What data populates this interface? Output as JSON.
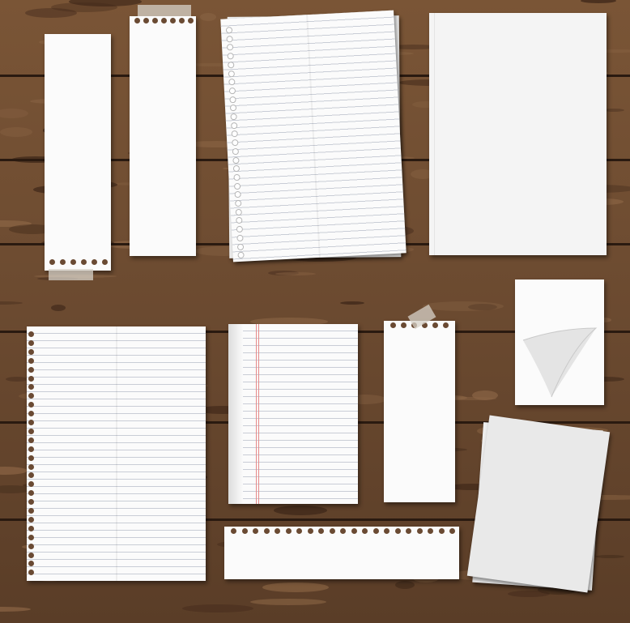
{
  "scene": {
    "background": "wood-planks",
    "wood_colors": {
      "base": "#6b4a30",
      "dark": "#3d2618",
      "light": "#8a6444",
      "seam": "#2a1a10"
    },
    "paper_color": "#fbfbfb",
    "line_color": "#c9cdd6",
    "margin_color": "#e58a8a"
  },
  "papers": [
    {
      "kind": "torn-strip-bottom-holes"
    },
    {
      "kind": "torn-strip-top-holes-taped"
    },
    {
      "kind": "ruled-spiral-sheet"
    },
    {
      "kind": "blank-sheet"
    },
    {
      "kind": "ruled-spiral-notebook-page"
    },
    {
      "kind": "ruled-notebook-with-margin"
    },
    {
      "kind": "taped-note-top-holes"
    },
    {
      "kind": "curled-corner-note"
    },
    {
      "kind": "torn-wide-strip"
    },
    {
      "kind": "stacked-blank-sheets"
    }
  ]
}
